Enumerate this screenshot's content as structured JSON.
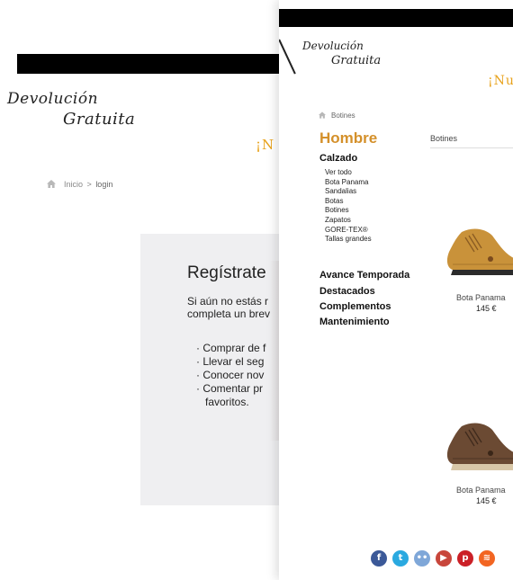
{
  "back_page": {
    "logo": {
      "line1": "Devolución",
      "line2": "Gratuita"
    },
    "promo_text": "¡N",
    "breadcrumb": {
      "home": "Inicio",
      "separator": ">",
      "current": "login"
    },
    "register": {
      "title": "Regístrate",
      "intro_line1": "Si aún no estás r",
      "intro_line2": "completa un brev",
      "benefits": [
        "Comprar de f",
        "Llevar el seg",
        "Conocer nov",
        "Comentar pr",
        "favoritos."
      ]
    }
  },
  "front_page": {
    "logo": {
      "line1": "Devolución",
      "line2": "Gratuita"
    },
    "promo_text": "¡Nu",
    "breadcrumb": {
      "current": "Botines"
    },
    "category_title": "Hombre",
    "category_tab": "Botines",
    "sidebar": {
      "calzado": "Calzado",
      "calzado_items": [
        "Ver todo",
        "Bota Panama",
        "Sandalias",
        "Botas",
        "Botines",
        "Zapatos",
        "GORE-TEX®",
        "Tallas grandes"
      ],
      "avance": "Avance Temporada",
      "destacados": "Destacados",
      "complementos": "Complementos",
      "mantenimiento": "Mantenimiento"
    },
    "products": [
      {
        "name": "Bota Panama",
        "price": "145 €",
        "color": "#c9923a"
      },
      {
        "name": "Bota Panama",
        "price": "145 €",
        "color": "#6b4a33"
      }
    ],
    "social_icons": [
      {
        "icon": "facebook-icon",
        "glyph": "f",
        "color": "#3b5998"
      },
      {
        "icon": "twitter-icon",
        "glyph": "t",
        "color": "#2aa9e0"
      },
      {
        "icon": "flickr-icon",
        "glyph": "••",
        "color": "#7fa7d8"
      },
      {
        "icon": "youtube-icon",
        "glyph": "▶",
        "color": "#c8463b"
      },
      {
        "icon": "pinterest-icon",
        "glyph": "p",
        "color": "#cb2027"
      },
      {
        "icon": "rss-icon",
        "glyph": "≋",
        "color": "#f26522"
      }
    ]
  }
}
